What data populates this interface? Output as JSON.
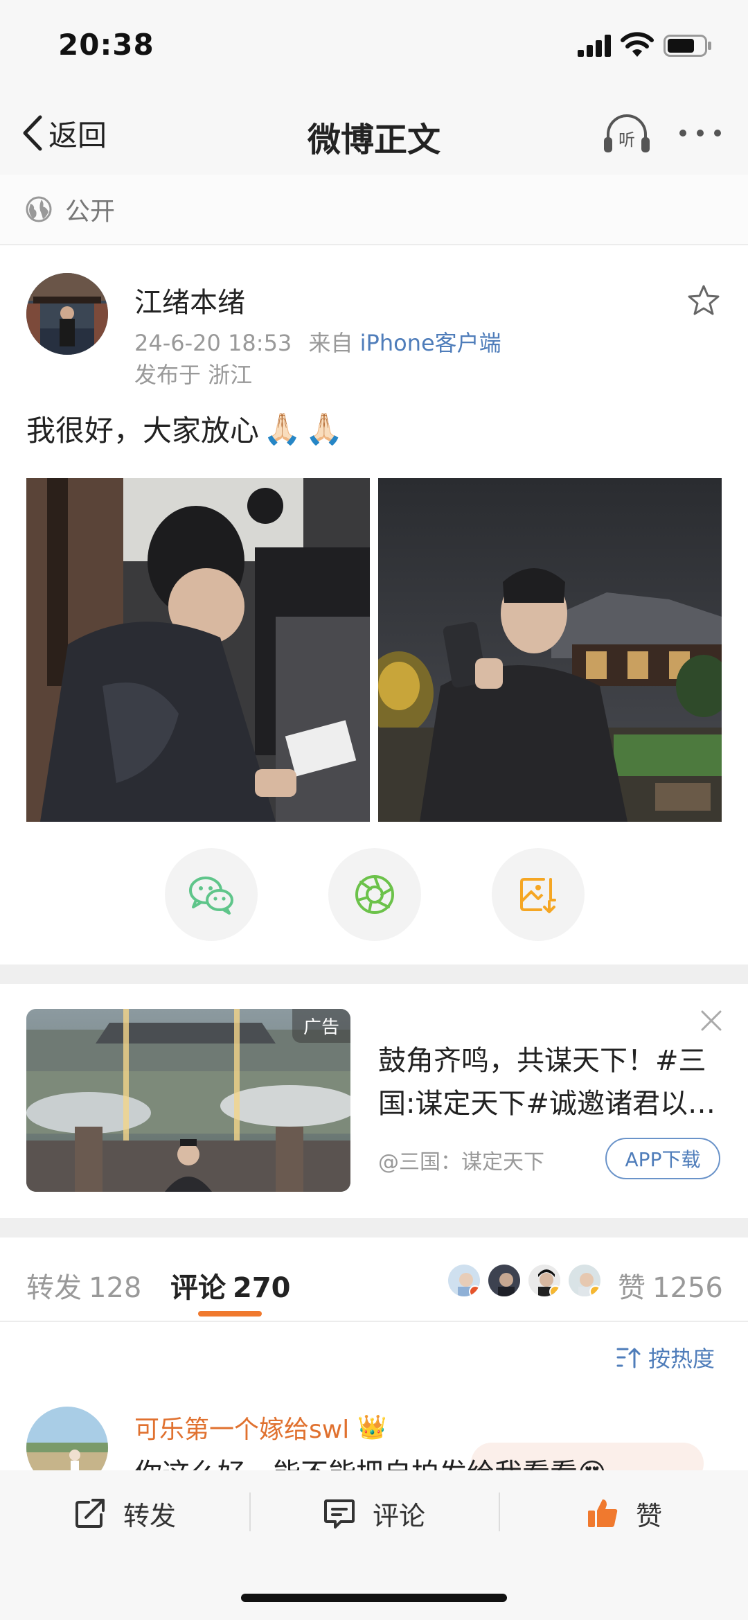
{
  "status_bar": {
    "time": "20:38"
  },
  "nav": {
    "back_label": "返回",
    "title": "微博正文",
    "listen_label": "听"
  },
  "visibility": {
    "label": "公开"
  },
  "post": {
    "author": "江绪本绪",
    "date": "24-6-20 18:53",
    "source_prefix": "来自",
    "source": "iPhone客户端",
    "location": "发布于 浙江",
    "text": "我很好，大家放心",
    "text_emoji": "🙏🏻🙏🏻",
    "photos": [
      "photo-1",
      "photo-2"
    ]
  },
  "share_buttons": [
    "wechat-icon",
    "moments-icon",
    "save-image-icon"
  ],
  "ad": {
    "badge": "广告",
    "text_line1": "鼓角齐鸣，共谋天下！#三",
    "text_line2": "国:谋定天下#诚邀诸君以…",
    "source": "@三国：谋定天下",
    "button": "APP下载"
  },
  "tabs": {
    "repost_label": "转发",
    "repost_count": "128",
    "comment_label": "评论",
    "comment_count": "270",
    "like_label": "赞",
    "like_count": "1256"
  },
  "sort": {
    "label": "按热度"
  },
  "comment": {
    "author": "可乐第一个嫁给swl",
    "badge_emoji": "👑",
    "text": "你这么好，能不能把自拍发给我看看😍"
  },
  "bottom_bar": {
    "repost": "转发",
    "comment": "评论",
    "like": "赞"
  },
  "colors": {
    "accent_orange": "#f0792e",
    "link_blue": "#4f7dba",
    "wechat_green": "#5fc58a",
    "save_orange": "#f5a623"
  }
}
